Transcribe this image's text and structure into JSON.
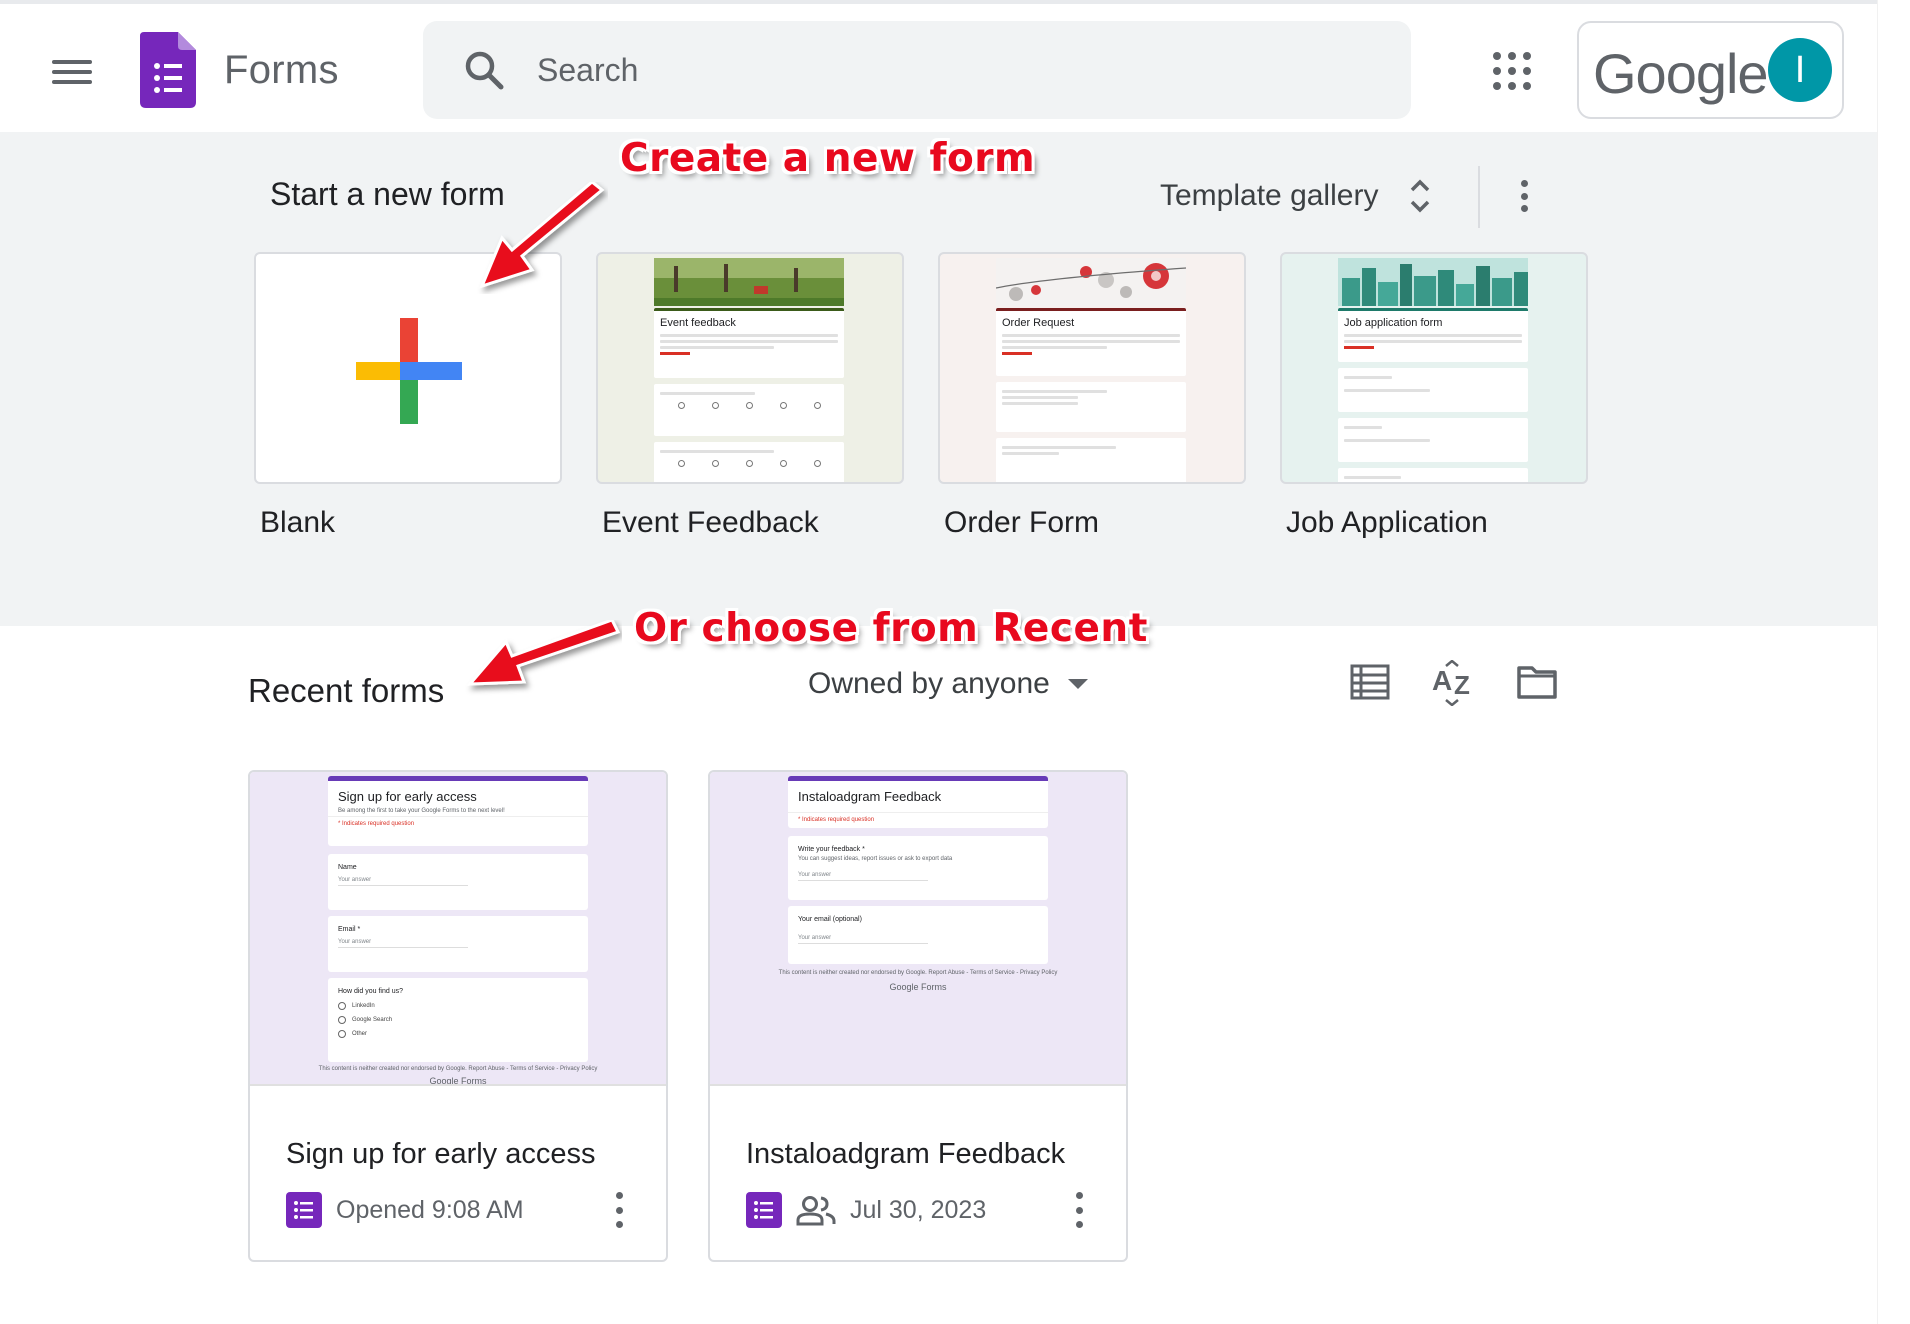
{
  "header": {
    "app_title": "Forms",
    "search_placeholder": "Search",
    "google_label": "Google",
    "avatar_initial": "I"
  },
  "templates": {
    "section_title": "Start a new form",
    "gallery_label": "Template gallery",
    "items": [
      {
        "label": "Blank"
      },
      {
        "label": "Event Feedback",
        "preview_title": "Event feedback"
      },
      {
        "label": "Order Form",
        "preview_title": "Order Request"
      },
      {
        "label": "Job Application",
        "preview_title": "Job application form"
      }
    ]
  },
  "recent": {
    "section_title": "Recent forms",
    "owner_filter": "Owned by anyone",
    "forms": [
      {
        "title": "Sign up for early access",
        "meta": "Opened 9:08 AM",
        "preview": {
          "title": "Sign up for early access",
          "subtitle": "Be among the first to take your Google Forms to the next level!",
          "required_note": "* Indicates required question",
          "q1": "Name",
          "q2": "Email *",
          "q3": "How did you find us?",
          "answer": "Your answer",
          "options": [
            "LinkedIn",
            "Google Search",
            "Other"
          ],
          "footer": "This content is neither created nor endorsed by Google. Report Abuse - Terms of Service - Privacy Policy",
          "brand": "Google Forms"
        }
      },
      {
        "title": "Instaloadgram Feedback",
        "meta": "Jul 30, 2023",
        "preview": {
          "title": "Instaloadgram Feedback",
          "required_note": "* Indicates required question",
          "q1": "Write your feedback *",
          "q1_sub": "You can suggest ideas, report issues or ask to export data",
          "q2": "Your email (optional)",
          "answer": "Your answer",
          "footer": "This content is neither created nor endorsed by Google. Report Abuse - Terms of Service - Privacy Policy",
          "brand": "Google Forms"
        }
      }
    ]
  },
  "annotations": {
    "create": "Create a new form",
    "recent": "Or choose from Recent"
  },
  "colors": {
    "forms_purple": "#7627bb",
    "avatar_teal": "#0097a7",
    "annotation_red": "#e8091e",
    "template_bg": "#f1f3f4"
  }
}
